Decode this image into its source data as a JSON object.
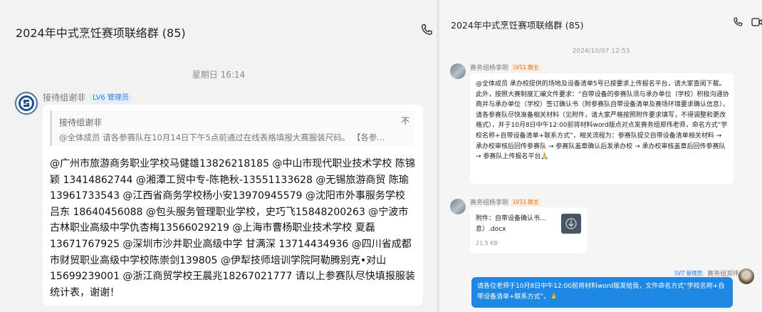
{
  "left": {
    "title": "2024年中式烹饪赛项联络群 (85)",
    "time": "星期日 16:14",
    "sender": "接待组谢非",
    "badge": "LV6 管理员",
    "quote": {
      "name": "接待组谢非",
      "close": "不",
      "text": "@全体成员 请各参赛队在10月14日下午5点前通过在线表格填报大赛服装尺码。 【各参..."
    },
    "message": "@广州市旅游商务职业学校马健雄13826218185 @中山市现代职业技术学校 陈锦颖 13414862744 @湘潭工贸中专-陈艳秋-13551133628 @无锡旅游商贸 陈瑜13961733543 @江西省商务学校杨小安13970945579 @沈阳市外事服务学校 吕东 18640456088 @包头服务管理职业学校，史巧飞15848200263 @宁波市古林职业高级中学仇杏梅13566029219 @上海市曹杨职业技术学校 夏磊13671767925 @深圳市沙井职业高级中学 甘满深 13714434936 @四川省成都市财贸职业高级中学校陈崇剑139805 @伊犁技师培训学院阿勒腾别克•对山15699239001 @浙江商贸学校王晨兆18267021777 请以上参赛队尽快填报服装统计表，谢谢！"
  },
  "right": {
    "title": "2024年中式烹饪赛项联络群 (85)",
    "time": "2024/10/07 12:53",
    "msg1": {
      "sender": "赛务组杨李刚",
      "badge": "LV11 群主",
      "text": "@全体成员 承办校提供的场地及设备清单5号已按要求上传报名平台，请大家查阅下载。此外，按照大赛制度汇编文件要求：“自带设备的参赛队须与承办单位（学校）积极沟通协商并与承办单位（学校）签订确认书（附参赛队自带设备清单及赛场环境要求确认信息），请各参赛队尽快准备相关材料（见附件，请大家严格按照附件要求填写，不得调整和更改格式），并于10月8日中午12:00前将材料word版点对点发赛务组郑伟老师，命名方式“学校名称+自带设备清单+联系方式”，相关流程为：参赛队提交自带设备清单相关材料 → 承办校审核后回传参赛队 → 参赛队盖章确认后发承办校 → 承办校审核盖章后回传参赛队 → 参赛队上传报名平台",
      "emoji": "🙏"
    },
    "msg2": {
      "sender": "赛务组杨李刚",
      "badge": "LV11 群主",
      "file_name": "附件：自带设备确认书...息）.docx",
      "file_size": "21.5 KB"
    },
    "msg3": {
      "badge": "LV7 管理员",
      "sender": "赛务组郑伟",
      "text": "请各位老师于10月8日中午12:00前将材料word版发给我，文件命名方式“学校名称+自带设备清单+联系方式”。",
      "emoji": "🙏"
    }
  }
}
